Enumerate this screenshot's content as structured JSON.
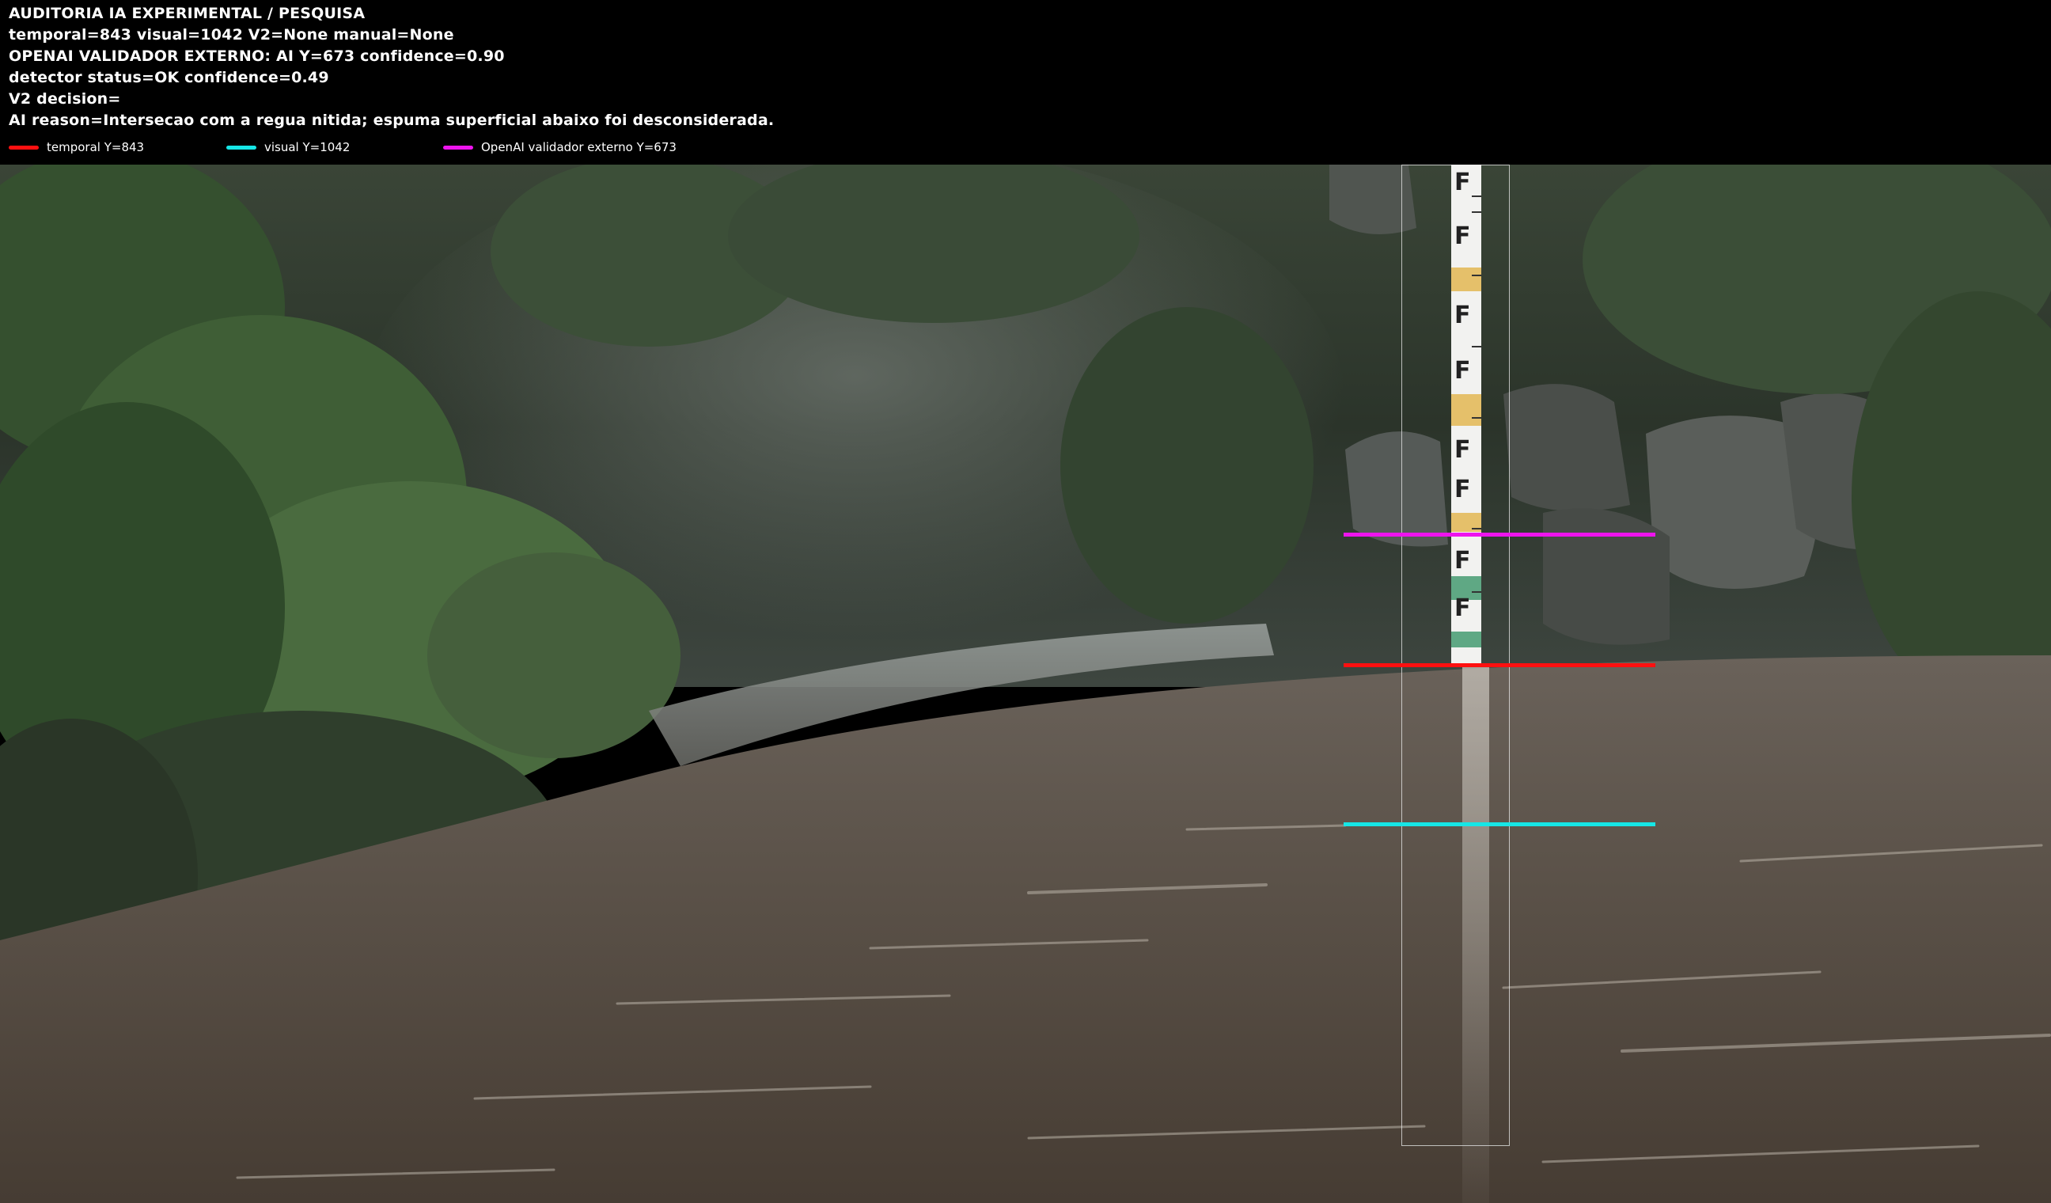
{
  "header": {
    "title": "AUDITORIA IA  EXPERIMENTAL / PESQUISA",
    "values_line": "temporal=843  visual=1042  V2=None  manual=None",
    "openai_line": "OPENAI  VALIDADOR EXTERNO: AI Y=673  confidence=0.90",
    "detector_line": "detector status=OK confidence=0.49",
    "v2_line": "V2 decision=",
    "reason_line": "AI reason=Intersecao com a regua nitida; espuma superficial abaixo foi desconsiderada."
  },
  "legend": [
    {
      "label": "temporal Y=843",
      "color": "#ff1010"
    },
    {
      "label": "visual Y=1042",
      "color": "#16e6e6"
    },
    {
      "label": "OpenAI validador externo Y=673",
      "color": "#ee14ee"
    }
  ],
  "colors": {
    "temporal": "#ff1010",
    "visual": "#16e6e6",
    "openai": "#ee14ee",
    "header_bg": "#000000",
    "header_text": "#ffffff",
    "water": "#5e5449",
    "forest_dark": "#2f3a2c"
  },
  "gauge": {
    "mark_letter": "F",
    "band_colors": [
      "#e5c06a",
      "#f2f2f2",
      "#5fa884"
    ]
  }
}
